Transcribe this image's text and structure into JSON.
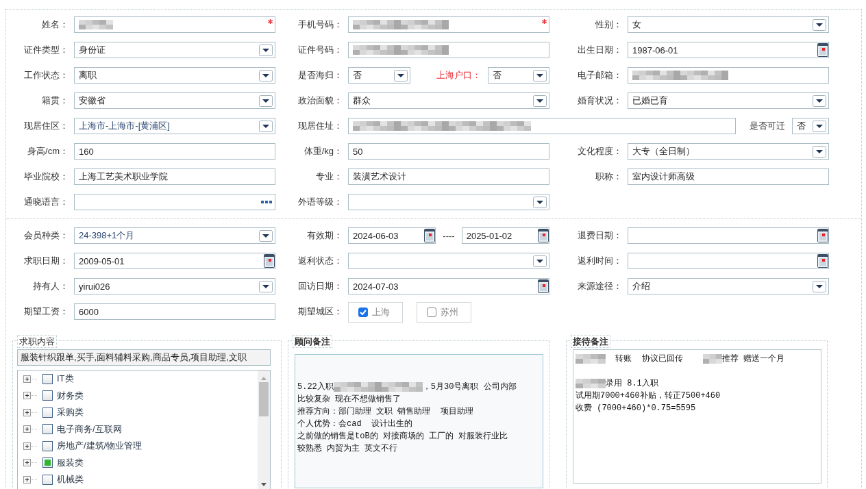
{
  "sections": [
    {
      "rows": [
        {
          "kind": "three",
          "cells": [
            {
              "label": "姓名：",
              "items": [
                {
                  "kind": "text",
                  "redacted": true,
                  "required": true
                }
              ]
            },
            {
              "label": "手机号码：",
              "items": [
                {
                  "kind": "text",
                  "redacted": true,
                  "required": true
                }
              ]
            },
            {
              "label": "性别：",
              "items": [
                {
                  "kind": "select",
                  "value": "女"
                }
              ]
            }
          ]
        },
        {
          "kind": "three",
          "cells": [
            {
              "label": "证件类型：",
              "items": [
                {
                  "kind": "select",
                  "value": "身份证"
                }
              ]
            },
            {
              "label": "证件号码：",
              "items": [
                {
                  "kind": "text",
                  "redacted": true
                }
              ]
            },
            {
              "label": "出生日期：",
              "items": [
                {
                  "kind": "date",
                  "value": "1987-06-01"
                }
              ]
            }
          ]
        },
        {
          "kind": "three",
          "cells": [
            {
              "label": "工作状态：",
              "items": [
                {
                  "kind": "select",
                  "value": "离职"
                }
              ]
            },
            {
              "label": "是否海归：",
              "items": [
                {
                  "kind": "select",
                  "value": "否"
                },
                {
                  "kind": "sublabel",
                  "text": "上海户口：",
                  "emphasis": true
                },
                {
                  "kind": "select",
                  "value": "否"
                }
              ]
            },
            {
              "label": "电子邮箱：",
              "items": [
                {
                  "kind": "text",
                  "redacted": true
                }
              ]
            }
          ]
        },
        {
          "kind": "three",
          "cells": [
            {
              "label": "籍贯：",
              "items": [
                {
                  "kind": "select",
                  "value": "安徽省"
                }
              ]
            },
            {
              "label": "政治面貌：",
              "items": [
                {
                  "kind": "select",
                  "value": "群众"
                }
              ]
            },
            {
              "label": "婚育状况：",
              "items": [
                {
                  "kind": "select",
                  "value": "已婚已育"
                }
              ]
            }
          ]
        },
        {
          "kind": "wide-middle",
          "cells": [
            {
              "label": "现居住区：",
              "items": [
                {
                  "kind": "select",
                  "value": "上海市-上海市-[黄浦区]"
                }
              ]
            },
            {
              "label": "现居住址：",
              "items": [
                {
                  "kind": "text",
                  "redacted": true
                },
                {
                  "kind": "sublabel",
                  "text": "是否可迁",
                  "emphasis": false
                },
                {
                  "kind": "select",
                  "value": "否"
                }
              ]
            }
          ]
        },
        {
          "kind": "three",
          "cells": [
            {
              "label": "身高/cm：",
              "items": [
                {
                  "kind": "text",
                  "value": "160"
                }
              ]
            },
            {
              "label": "体重/kg：",
              "items": [
                {
                  "kind": "text",
                  "value": "50"
                }
              ]
            },
            {
              "label": "文化程度：",
              "items": [
                {
                  "kind": "select",
                  "value": "大专（全日制）"
                }
              ]
            }
          ]
        },
        {
          "kind": "three",
          "cells": [
            {
              "label": "毕业院校：",
              "items": [
                {
                  "kind": "text",
                  "value": "上海工艺美术职业学院"
                }
              ]
            },
            {
              "label": "专业：",
              "items": [
                {
                  "kind": "text",
                  "value": "装潢艺术设计"
                }
              ]
            },
            {
              "label": "职称：",
              "items": [
                {
                  "kind": "text",
                  "value": "室内设计师高级"
                }
              ]
            }
          ]
        },
        {
          "kind": "three",
          "cells": [
            {
              "label": "通晓语言：",
              "items": [
                {
                  "kind": "lookup"
                }
              ]
            },
            {
              "label": "外语等级：",
              "items": [
                {
                  "kind": "select"
                }
              ]
            }
          ]
        }
      ]
    },
    {
      "rows": [
        {
          "kind": "three",
          "cells": [
            {
              "label": "会员种类：",
              "items": [
                {
                  "kind": "select",
                  "value": "24-398+1个月"
                }
              ]
            },
            {
              "label": "有效期：",
              "items": [
                {
                  "kind": "date",
                  "value": "2024-06-03"
                },
                {
                  "kind": "separator",
                  "text": "----"
                },
                {
                  "kind": "date",
                  "value": "2025-01-02"
                }
              ]
            },
            {
              "label": "退费日期：",
              "items": [
                {
                  "kind": "date"
                }
              ]
            }
          ]
        },
        {
          "kind": "three",
          "cells": [
            {
              "label": "求职日期：",
              "items": [
                {
                  "kind": "date",
                  "value": "2009-05-01"
                }
              ]
            },
            {
              "label": "返利状态：",
              "items": [
                {
                  "kind": "select"
                }
              ]
            },
            {
              "label": "返利时间：",
              "items": [
                {
                  "kind": "date"
                }
              ]
            }
          ]
        },
        {
          "kind": "three",
          "cells": [
            {
              "label": "持有人：",
              "items": [
                {
                  "kind": "select",
                  "value": "yirui026"
                }
              ]
            },
            {
              "label": "回访日期：",
              "items": [
                {
                  "kind": "date",
                  "value": "2024-07-03"
                }
              ]
            },
            {
              "label": "来源途径：",
              "items": [
                {
                  "kind": "select",
                  "value": "介绍"
                }
              ]
            }
          ]
        },
        {
          "kind": "three",
          "cells": [
            {
              "label": "期望工资：",
              "items": [
                {
                  "kind": "text",
                  "value": "6000"
                }
              ]
            },
            {
              "label": "期望城区：",
              "items": [
                {
                  "kind": "checkbox",
                  "text": "上海",
                  "checked": true
                },
                {
                  "kind": "checkbox",
                  "text": "苏州",
                  "checked": false
                }
              ]
            }
          ]
        }
      ]
    }
  ],
  "panels": [
    {
      "kind": "tree",
      "title": "求职内容",
      "value": "服装针织跟单,买手,面料辅料采购,商品专员,项目助理,文职",
      "items": [
        {
          "label": "IT类",
          "checked": false,
          "expanded": false
        },
        {
          "label": "财务类",
          "checked": false,
          "expanded": false
        },
        {
          "label": "采购类",
          "checked": false,
          "expanded": false
        },
        {
          "label": "电子商务/互联网",
          "checked": false,
          "expanded": false
        },
        {
          "label": "房地产/建筑/物业管理",
          "checked": false,
          "expanded": false
        },
        {
          "label": "服装类",
          "checked": true,
          "expanded": false
        },
        {
          "label": "机械类",
          "checked": false,
          "expanded": false
        }
      ]
    },
    {
      "kind": "note",
      "title": "顾问备注",
      "paragraphs": [
        [
          [
            "5.22入职",
            {
              "kind": "redacted"
            },
            "，5月30号离职 公司内部"
          ],
          [
            "比较复杂 现在不想做销售了"
          ],
          [
            "推荐方向：部门助理 文职 销售助理  项目助理"
          ],
          [
            "个人优势：会cad  设计出生的"
          ],
          [
            "之前做的销售是toB的 对接商场的 工厂的 对服装行业比"
          ],
          [
            "较熟悉 内贸为主 英文不行"
          ]
        ]
      ]
    },
    {
      "kind": "note",
      "title": "接待备注",
      "paragraphs": [
        [
          [
            {
              "kind": "redacted"
            },
            "  转账  协议已回传    ",
            {
              "kind": "redacted"
            },
            "推荐 赠送一个月"
          ]
        ],
        [
          [
            {
              "kind": "redacted"
            },
            "录用 8.1入职"
          ],
          [
            "试用期7000+460补贴，转正7500+460"
          ],
          [
            "收费 (7000+460)*0.75=5595"
          ]
        ]
      ]
    }
  ]
}
